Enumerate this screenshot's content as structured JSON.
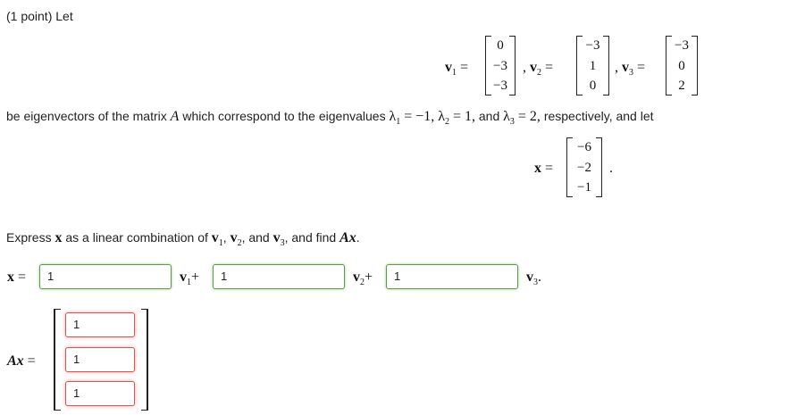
{
  "header": "(1 point) Let",
  "vectors": {
    "v1": {
      "label": "v",
      "sub": "1",
      "entries": [
        "0",
        "−3",
        "−3"
      ]
    },
    "v2": {
      "label": "v",
      "sub": "2",
      "entries": [
        "−3",
        "1",
        "0"
      ]
    },
    "v3": {
      "label": "v",
      "sub": "3",
      "entries": [
        "−3",
        "0",
        "2"
      ]
    }
  },
  "eig_sentence": {
    "prefix": "be eigenvectors of the matrix",
    "matrix": "A",
    "middle": "which correspond to the eigenvalues",
    "l1": "λ",
    "l1_sub": "1",
    "l1_val": "= −1,",
    "l2": "λ",
    "l2_sub": "2",
    "l2_val": "= 1,",
    "and1": "and",
    "l3": "λ",
    "l3_sub": "3",
    "l3_val": "= 2,",
    "suffix": "respectively, and let"
  },
  "x_vector": {
    "label": "x",
    "eq": "=",
    "entries": [
      "−6",
      "−2",
      "−1"
    ],
    "period": "."
  },
  "instruction": {
    "p1": "Express",
    "x": "x",
    "p2": "as a linear combination of",
    "v1": "v",
    "s1": "1",
    "comma1": ",",
    "v2": "v",
    "s2": "2",
    "comma2": ", and",
    "v3": "v",
    "s3": "3",
    "p3": ", and find",
    "ax": "Ax",
    "period": "."
  },
  "combo": {
    "x_label": "x",
    "eq": "=",
    "c1_value": "1",
    "c2_value": "1",
    "c3_value": "1",
    "t1": "v",
    "t1s": "1",
    "plus1": "+",
    "t2": "v",
    "t2s": "2",
    "plus2": "+",
    "t3": "v",
    "t3s": "3",
    "period": "."
  },
  "ax_answer": {
    "label": "Ax",
    "eq": "=",
    "entries": [
      "1",
      "1",
      "1"
    ]
  }
}
